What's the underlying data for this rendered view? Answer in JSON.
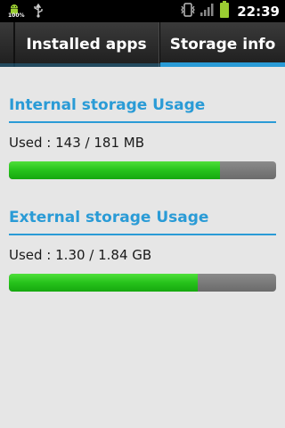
{
  "status_bar": {
    "time": "22:39",
    "battery_text": "100%",
    "icons": [
      "android-icon",
      "usb-icon",
      "vibrate-icon",
      "signal-icon",
      "battery-icon"
    ]
  },
  "tabs": [
    {
      "label": "Installed apps",
      "selected": false
    },
    {
      "label": "Storage info",
      "selected": true
    }
  ],
  "internal": {
    "title": "Internal storage Usage",
    "used_label": "Used : 143 / 181 MB",
    "used": 143,
    "total": 181
  },
  "external": {
    "title": "External storage Usage",
    "used_label": "Used : 1.30 / 1.84 GB",
    "used": 1.3,
    "total": 1.84
  },
  "colors": {
    "accent": "#2a9bd6",
    "bar_fill": "#26c21b",
    "bar_track": "#767676",
    "background": "#e6e6e6"
  }
}
